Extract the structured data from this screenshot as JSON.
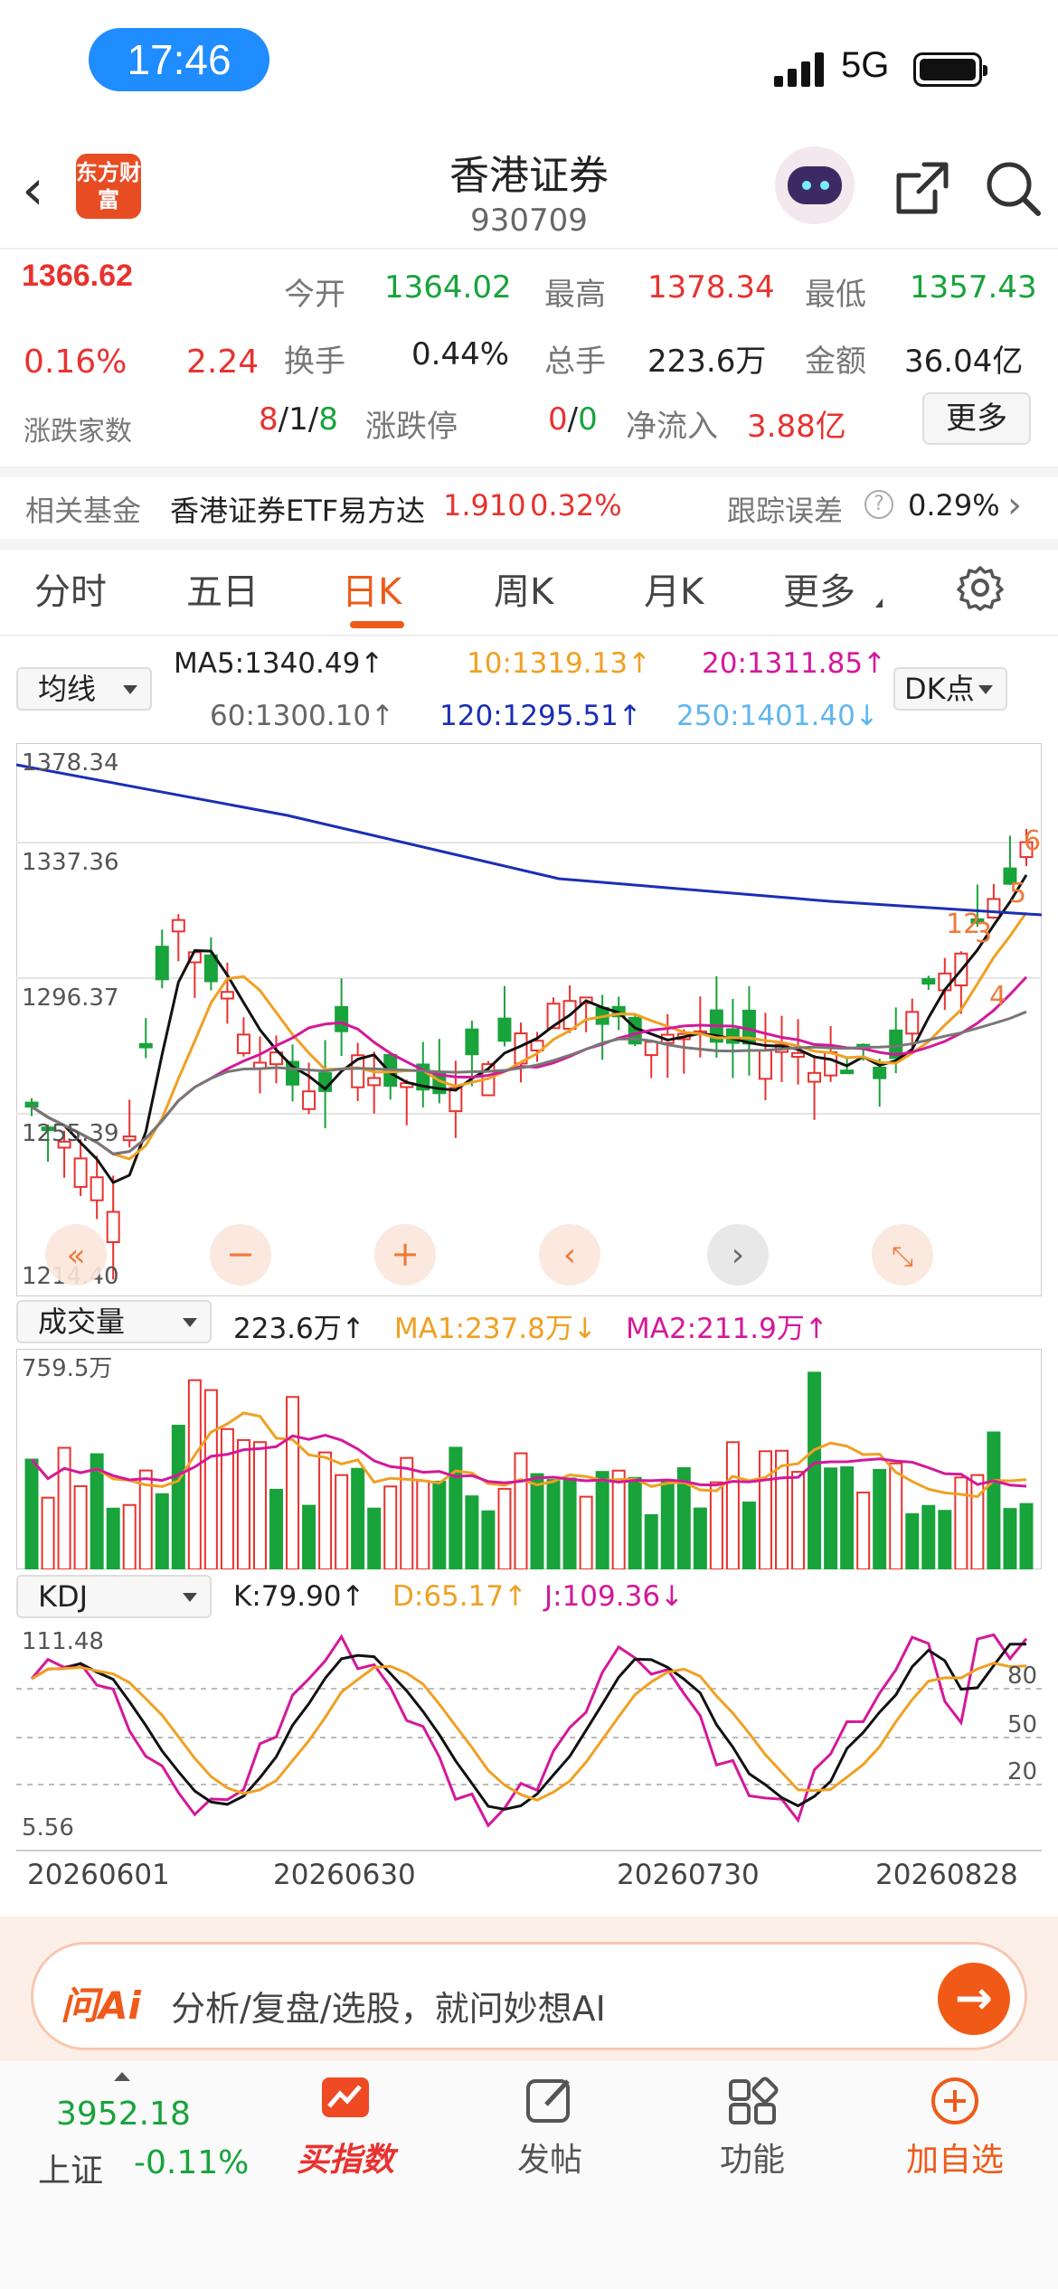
{
  "status": {
    "time": "17:46",
    "network": "5G"
  },
  "header": {
    "logo_text": "东方财富",
    "title": "香港证券",
    "code": "930709"
  },
  "quote": {
    "price": "1366.62",
    "change_pct": "0.16%",
    "change": "2.24",
    "open_label": "今开",
    "open": "1364.02",
    "high_label": "最高",
    "high": "1378.34",
    "low_label": "最低",
    "low": "1357.43",
    "turnover_label": "换手",
    "turnover": "0.44%",
    "volume_label": "总手",
    "volume": "223.6万",
    "amount_label": "金额",
    "amount": "36.04亿",
    "breadth_label": "涨跌家数",
    "breadth_up": "8",
    "breadth_flat": "1",
    "breadth_down": "8",
    "breadth_sep": "/",
    "limit_label": "涨跌停",
    "limit_up": "0",
    "limit_sep": "/",
    "limit_down": "0",
    "inflow_label": "净流入",
    "inflow": "3.88亿",
    "more": "更多"
  },
  "fund": {
    "label": "相关基金",
    "name": "香港证券ETF易方达",
    "price": "1.910",
    "pct": "0.32%",
    "err_label": "跟踪误差",
    "err": "0.29%"
  },
  "tabs": [
    "分时",
    "五日",
    "日K",
    "周K",
    "月K",
    "更多"
  ],
  "ma_panel": {
    "selector": "均线",
    "ma5": "MA5:1340.49↑",
    "ma10": "10:1319.13↑",
    "ma20": "20:1311.85↑",
    "ma60": "60:1300.10↑",
    "ma120": "120:1295.51↑",
    "ma250": "250:1401.40↓",
    "dk": "DK点"
  },
  "kline": {
    "y_labels": [
      "1378.34",
      "1337.36",
      "1296.37",
      "1255.39",
      "1214.40"
    ],
    "markers": [
      "12",
      "3",
      "4",
      "5",
      "6"
    ]
  },
  "volume_panel": {
    "selector": "成交量",
    "vol": "223.6万↑",
    "ma1": "MA1:237.8万↓",
    "ma2": "MA2:211.9万↑",
    "max_label": "759.5万"
  },
  "kdj_panel": {
    "selector": "KDJ",
    "k": "K:79.90↑",
    "d": "D:65.17↑",
    "j": "J:109.36↓",
    "max_label": "111.48",
    "min_label": "5.56",
    "levels": [
      "80",
      "50",
      "20"
    ]
  },
  "dates": [
    "20260601",
    "20260630",
    "20260730",
    "20260828"
  ],
  "ai": {
    "logo": "问Ai",
    "placeholder": "分析/复盘/选股，就问妙想AI"
  },
  "bottom_nav": {
    "index_value": "3952.18",
    "index_name": "上证",
    "index_pct": "-0.11%",
    "items": [
      "买指数",
      "发帖",
      "功能",
      "加自选"
    ]
  },
  "colors": {
    "up": "#e8322f",
    "down": "#18a33b",
    "accent": "#ef5a1a"
  }
}
